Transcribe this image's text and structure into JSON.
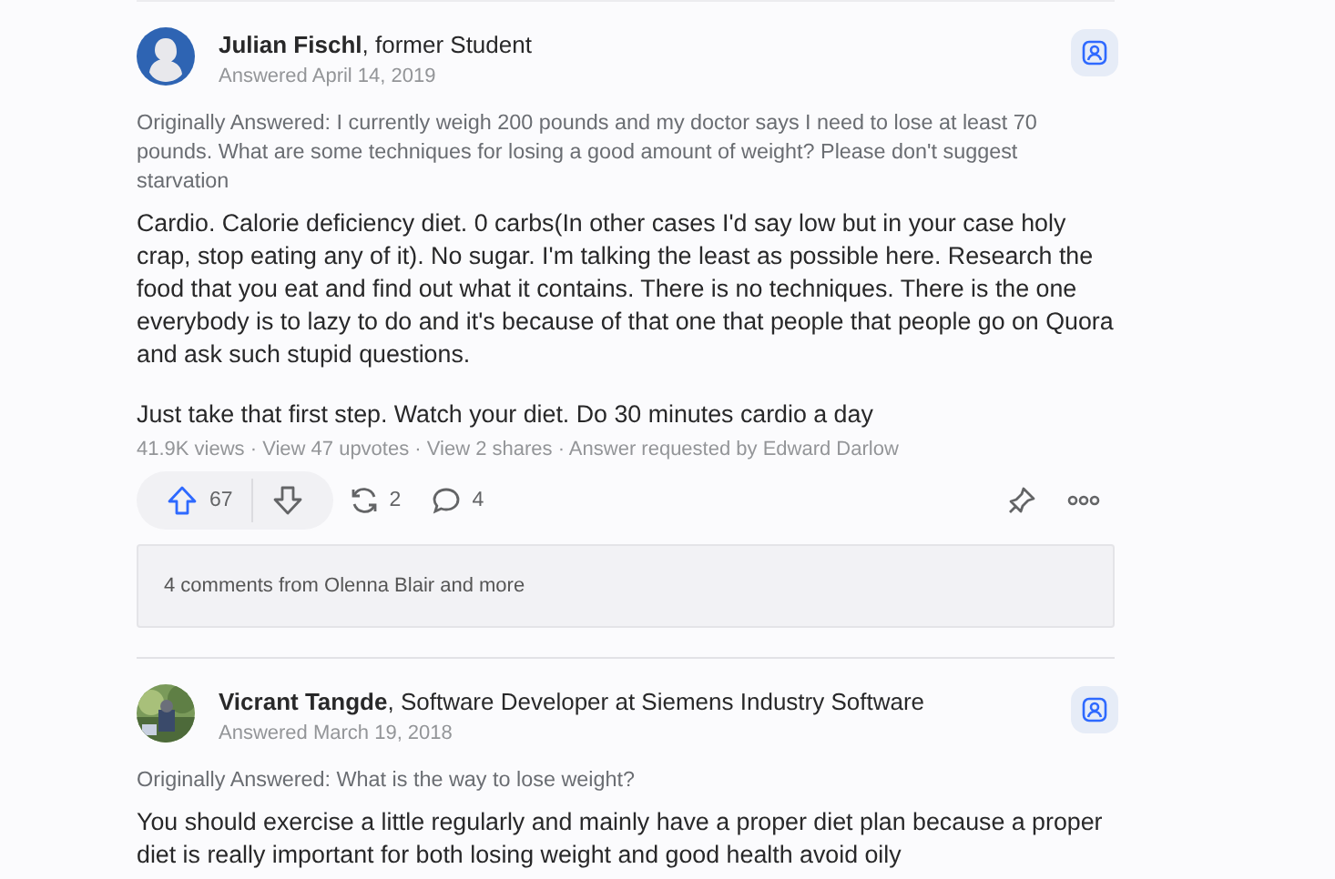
{
  "answers": [
    {
      "byline": "**Julian Fischl**, former Student",
      "date": "Answered April 14, 2019",
      "avatar": {
        "kind": "silhouette"
      },
      "question": "Originally Answered: I currently weigh 200 pounds and my doctor says I need to lose at least 70 pounds. What are some techniques for losing a good amount of weight? Please don't suggest starvation",
      "paragraphs": [
        "Cardio. Calorie deficiency diet. 0 carbs(In other cases I'd say low but in your case holy crap, stop eating any of it). No sugar. I'm talking the least as possible here. Research the food that you eat and find out what it contains. There is no techniques. There is the one everybody is to lazy to do and it's because of that one that people that people go on Quora and ask such stupid questions.",
        "Just take that first step. Watch your diet. Do 30 minutes cardio a day"
      ],
      "stats": "41.9K views · View 47 upvotes · View 2 shares · Answer requested by Edward Darlow",
      "actions": {
        "upvotes": "67",
        "shares": "2",
        "comments": "4"
      },
      "comments_preview": "4 comments from Olenna Blair and more"
    },
    {
      "byline": "**Vicrant Tangde**, Software Developer at Siemens Industry Software",
      "date": "Answered March 19, 2018",
      "avatar": {
        "kind": "picture"
      },
      "question": "Originally Answered: What is the way to lose weight?",
      "paragraphs": [
        "You should exercise a little regularly and mainly have a proper diet plan because a proper diet is really important for both losing weight and good health avoid oily"
      ]
    }
  ]
}
